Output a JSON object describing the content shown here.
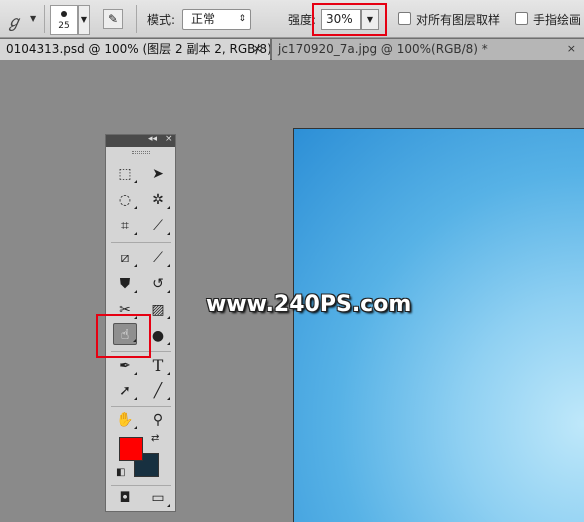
{
  "options": {
    "brush_size": "25",
    "mode_label": "模式:",
    "mode_value": "正常",
    "strength_label": "强度:",
    "strength_value": "30%",
    "sample_all_label": "对所有图层取样",
    "finger_paint_label": "手指绘画"
  },
  "tabs": [
    {
      "label": "0104313.psd @ 100% (图层 2 副本 2, RGB/8) *",
      "close": "×"
    },
    {
      "label": "jc170920_7a.jpg @ 100%(RGB/8) *",
      "close": "×"
    }
  ],
  "watermark": "www.240PS.com",
  "toolbox": {
    "collapse_label": "◂◂",
    "close_label": "×",
    "foreground_color": "#ff0000",
    "background_color": "#173040",
    "selected_tool": "smudge-tool"
  },
  "icons": {
    "tool_preset": "smudge-icon",
    "brush_panel": "brush-panel-icon"
  },
  "colors": {
    "highlight": "#e60012"
  }
}
